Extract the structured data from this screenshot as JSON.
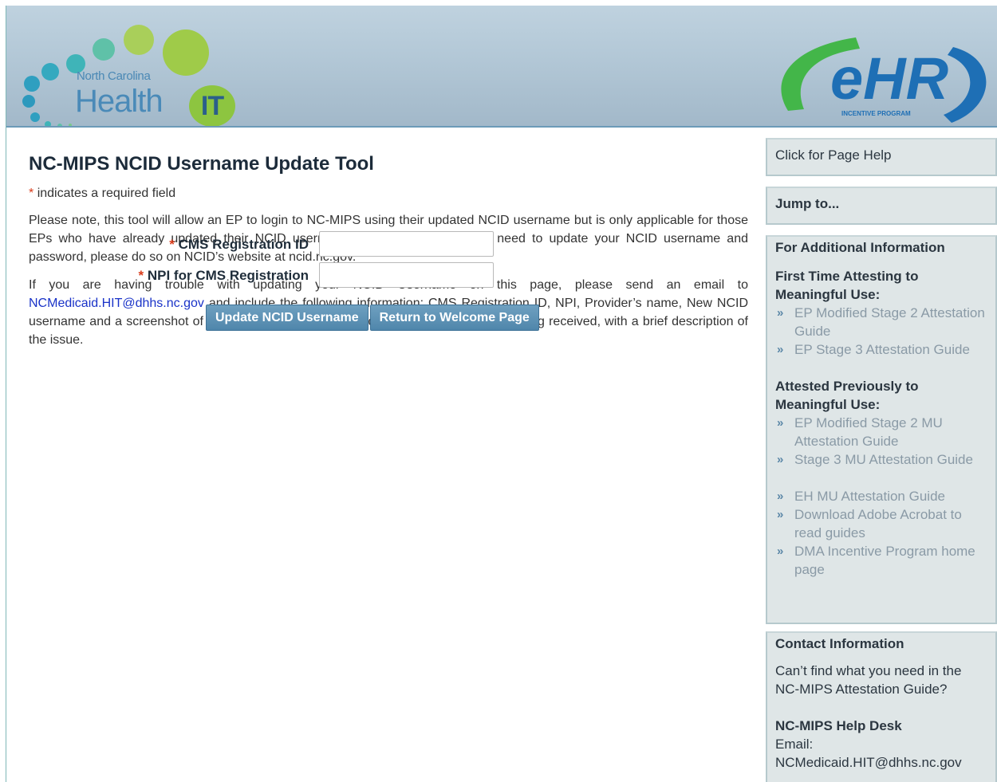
{
  "header": {
    "logo_small": "North Carolina",
    "logo_large": "Health",
    "logo_badge": "IT",
    "ehr_logo_text": "eHR",
    "ehr_logo_sub": "INCENTIVE PROGRAM"
  },
  "main": {
    "title": "NC-MIPS NCID Username Update Tool",
    "required_star": "*",
    "required_note": "indicates a required field",
    "para1": "Please note, this tool will allow an EP to login to NC-MIPS using their updated NCID username but is only applicable for those EPs who have already updated their NCID usernames on ncid.nc.gov. If you need to update your NCID username and password, please do so on NCID’s website at ncid.nc.gov.",
    "para2_before": "If you are having trouble with updating your NCID Username on this page, please send an email to ",
    "para2_email": "NCMedicaid.HIT@dhhs.nc.gov",
    "para2_after": " and include the following information: CMS Registration ID, NPI, Provider’s name, New NCID username and a screenshot of the information being entered and the error message being received, with a brief description of the issue."
  },
  "form": {
    "fields": [
      {
        "star": "*",
        "label": "CMS Registration ID",
        "value": ""
      },
      {
        "star": "*",
        "label": "NPI for CMS Registration",
        "value": ""
      }
    ],
    "update_button": "Update NCID Username",
    "return_button": "Return to Welcome Page"
  },
  "sidebar": {
    "help": "Click for Page Help",
    "jump": "Jump to...",
    "info_heading": "For Additional Information",
    "first_time_heading": "First Time Attesting to Meaningful Use:",
    "first_time_links": [
      "EP Modified Stage 2 Attestation Guide",
      "EP Stage 3 Attestation Guide"
    ],
    "previous_heading": "Attested Previously to Meaningful Use:",
    "previous_links": [
      "EP Modified Stage 2 MU Attestation Guide",
      "Stage 3 MU Attestation Guide"
    ],
    "other_links": [
      "EH MU Attestation Guide",
      "Download Adobe Acrobat to read guides",
      "DMA Incentive Program home page"
    ],
    "bullet": "»",
    "contact_heading": "Contact Information",
    "contact_text": "Can’t find what you need in the NC-MIPS Attestation Guide?",
    "helpdesk_heading": "NC-MIPS Help Desk",
    "email_label": "Email:",
    "email": "NCMedicaid.HIT@dhhs.nc.gov"
  }
}
